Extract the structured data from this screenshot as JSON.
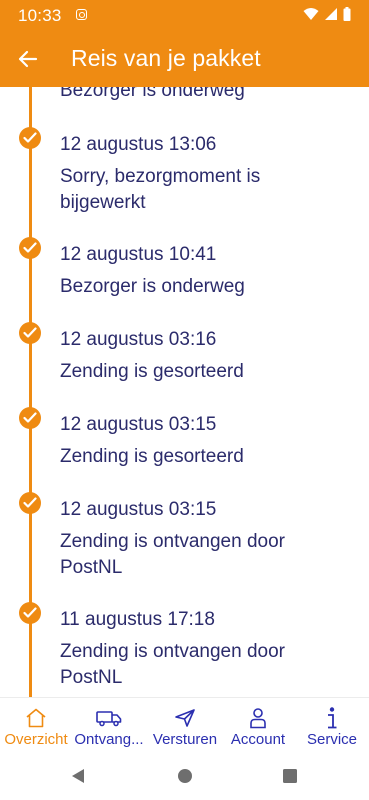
{
  "status_bar": {
    "time": "10:33"
  },
  "header": {
    "title": "Reis van je pakket"
  },
  "timeline": {
    "partial_status": "Bezorger is onderweg",
    "events": [
      {
        "date": "12 augustus 13:06",
        "status": "Sorry, bezorgmoment is bijgewerkt"
      },
      {
        "date": "12 augustus 10:41",
        "status": "Bezorger is onderweg"
      },
      {
        "date": "12 augustus 03:16",
        "status": "Zending is gesorteerd"
      },
      {
        "date": "12 augustus 03:15",
        "status": "Zending is gesorteerd"
      },
      {
        "date": "12 augustus 03:15",
        "status": "Zending is ontvangen door PostNL"
      },
      {
        "date": "11 augustus 17:18",
        "status": "Zending is ontvangen door PostNL"
      }
    ]
  },
  "bottom_nav": {
    "items": [
      {
        "label": "Overzicht",
        "icon": "home-icon",
        "active": true
      },
      {
        "label": "Ontvang...",
        "icon": "truck-icon",
        "active": false
      },
      {
        "label": "Versturen",
        "icon": "send-icon",
        "active": false
      },
      {
        "label": "Account",
        "icon": "person-icon",
        "active": false
      },
      {
        "label": "Service",
        "icon": "info-icon",
        "active": false
      }
    ]
  },
  "colors": {
    "brand": "#ef8b12",
    "text": "#2b2b6b",
    "nav_text": "#2b2fb0"
  }
}
